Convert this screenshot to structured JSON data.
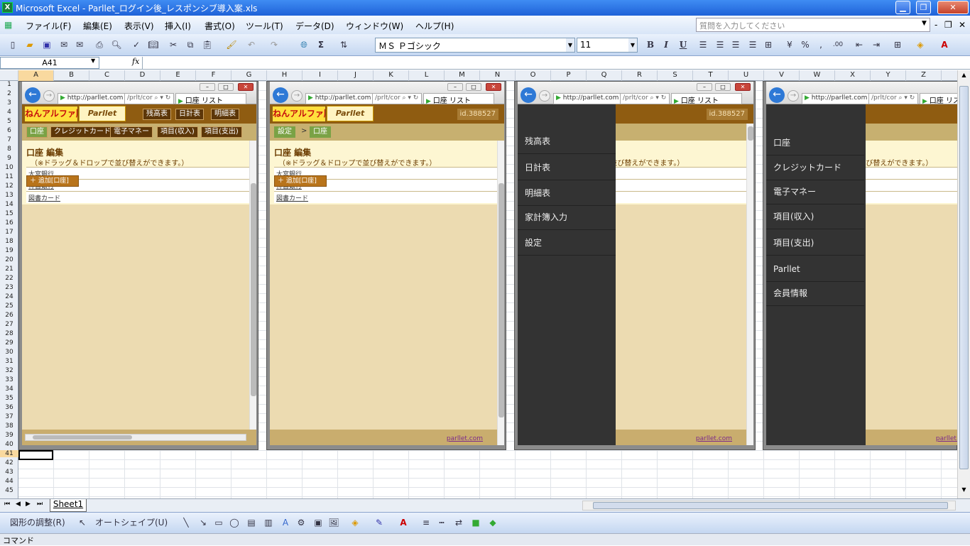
{
  "window": {
    "title": "Microsoft Excel - Parllet_ログイン後_レスポンシブ導入案.xls"
  },
  "menu": {
    "items": [
      "ファイル(F)",
      "編集(E)",
      "表示(V)",
      "挿入(I)",
      "書式(O)",
      "ツール(T)",
      "データ(D)",
      "ウィンドウ(W)",
      "ヘルプ(H)"
    ],
    "ask_placeholder": "質問を入力してください"
  },
  "toolbar": {
    "font_name": "ＭＳ Ｐゴシック",
    "font_size": "11"
  },
  "formula": {
    "name_box": "A41",
    "fx": "fx"
  },
  "columns": [
    "A",
    "B",
    "C",
    "D",
    "E",
    "F",
    "G",
    "H",
    "I",
    "J",
    "K",
    "L",
    "M",
    "N",
    "O",
    "P",
    "Q",
    "R",
    "S",
    "T",
    "U",
    "V",
    "W",
    "X",
    "Y",
    "Z"
  ],
  "rows": [
    "1",
    "2",
    "3",
    "4",
    "5",
    "6",
    "7",
    "8",
    "9",
    "10",
    "11",
    "12",
    "13",
    "14",
    "15",
    "16",
    "17",
    "18",
    "19",
    "20",
    "21",
    "22",
    "23",
    "24",
    "25",
    "26",
    "27",
    "28",
    "29",
    "30",
    "31",
    "32",
    "33",
    "34",
    "35",
    "36",
    "37",
    "38",
    "39",
    "40",
    "41",
    "42",
    "43",
    "44",
    "45"
  ],
  "browser": {
    "url": "http://parllet.com",
    "url_rest": "/prlt/cor",
    "tab_title": "口座 リスト"
  },
  "site": {
    "logo_text": "ねんアルファ版",
    "logo2_text": "Parllet",
    "nav_top": [
      "残高表",
      "日計表",
      "明細表"
    ],
    "nav_sub": [
      "口座",
      "クレジットカード",
      "電子マネー",
      "項目(収入)",
      "項目(支出)"
    ],
    "user_id": "id.388527",
    "breadcrumb": [
      "設定",
      ">",
      "口座"
    ],
    "page_title": "口座 編集",
    "note": "（※ドラッグ＆ドロップで並び替えができます。）",
    "accounts": [
      "大宮銀行",
      "神宮銀行",
      "図書カード"
    ],
    "add_button": "追加[口座]",
    "footer_link": "parllet.com"
  },
  "drawer_left": [
    "残高表",
    "日計表",
    "明細表",
    "家計簿入力",
    "設定"
  ],
  "drawer_right": [
    "口座",
    "クレジットカード",
    "電子マネー",
    "項目(収入)",
    "項目(支出)",
    "Parllet",
    "会員情報"
  ],
  "sheet": {
    "tab": "Sheet1"
  },
  "drawbar": {
    "adjust": "図形の調整(R)",
    "autoshape": "オートシェイプ(U)"
  },
  "status": {
    "mode": "コマンド"
  }
}
